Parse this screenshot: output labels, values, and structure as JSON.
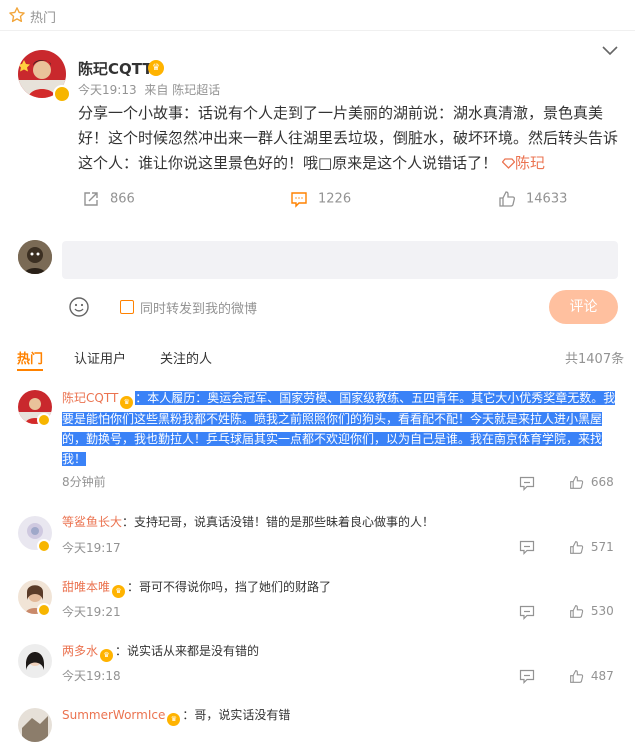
{
  "header": {
    "hot_label": "热门"
  },
  "post": {
    "author": "陈玘CQTT",
    "time": "今天19:13",
    "source": "来自 陈玘超话",
    "text": "分享一个小故事：话说有个人走到了一片美丽的湖前说：湖水真清澈，景色真美好！这个时候忽然冲出来一群人往湖里丢垃圾，倒脏水，破坏环境。然后转头告诉这个人：谁让你说这里景色好的！哦□原来是这个人说错话了！",
    "tag": "陈玘",
    "repost_count": "866",
    "comment_count": "1226",
    "like_count": "14633"
  },
  "composer": {
    "placeholder": "",
    "also_forward_label": "同时转发到我的微博",
    "submit_label": "评论"
  },
  "tabs": [
    {
      "label": "热门",
      "active": true
    },
    {
      "label": "认证用户",
      "active": false
    },
    {
      "label": "关注的人",
      "active": false
    }
  ],
  "total_label": "共1407条",
  "comments": [
    {
      "name": "陈玘CQTT",
      "sep": "：",
      "text": "本人履历：奥运会冠军、国家劳模、国家级教练、五四青年。其它大小优秀奖章无数。我要是能怕你们这些黑粉我都不姓陈。喷我之前照照你们的狗头，看看配不配！今天就是来拉人进小黑屋的，勤换号，我也勤拉人！乒乓球届其实一点都不欢迎你们，以为自己是谁。我在南京体育学院，来找我！",
      "time": "8分钟前",
      "likes": "668"
    },
    {
      "name": "等鲨鱼长大",
      "sep": "：",
      "text": "支持玘哥，说真话没错！错的是那些昧着良心做事的人！",
      "time": "今天19:17",
      "likes": "571"
    },
    {
      "name": "甜唯本唯",
      "sep": "：",
      "text": "哥可不得说你吗，挡了她们的财路了",
      "time": "今天19:21",
      "likes": "530"
    },
    {
      "name": "两多水",
      "sep": "：",
      "text": "说实话从来都是没有错的",
      "time": "今天19:18",
      "likes": "487"
    },
    {
      "name": "SummerWormIce",
      "sep": "：",
      "text": "哥，说实话没有错",
      "time": "",
      "likes": ""
    }
  ],
  "colors": {
    "accent": "#ff8200",
    "link": "#eb7350",
    "selection": "#3a82f7",
    "submit_bg": "#ffc09f"
  },
  "icons": {
    "hot": "star-icon",
    "collapse": "chevron-down-icon",
    "repost": "repost-icon",
    "comment": "comment-icon",
    "like": "thumb-up-icon",
    "emoji": "smile-icon"
  }
}
